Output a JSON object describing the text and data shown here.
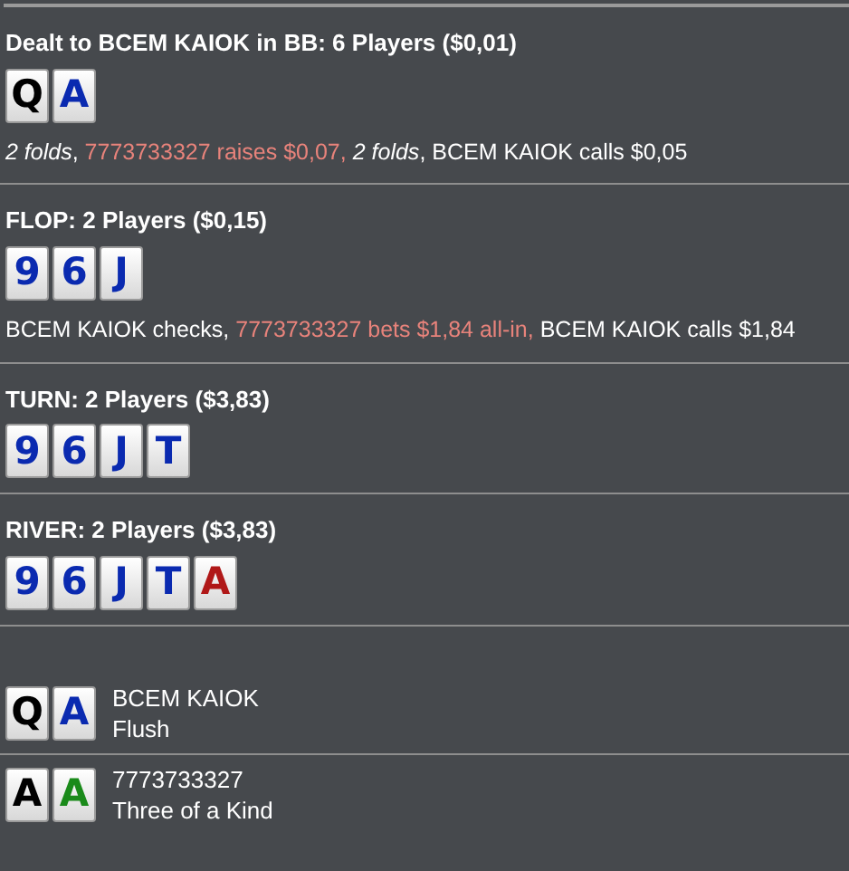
{
  "streets": [
    {
      "title": "Dealt to BCEM KAIOK in BB: 6 Players ($0,01)",
      "cards": [
        {
          "rank": "Q",
          "color": "#000000"
        },
        {
          "rank": "A",
          "color": "#0a2ab0"
        }
      ],
      "actions": [
        {
          "text": "2 folds",
          "kind": "fold"
        },
        {
          "text": ", ",
          "kind": "plain"
        },
        {
          "text": "7773733327 raises $0,07, ",
          "kind": "bet"
        },
        {
          "text": "2 folds",
          "kind": "fold"
        },
        {
          "text": ", BCEM KAIOK calls $0,05",
          "kind": "plain"
        }
      ]
    },
    {
      "title": "FLOP: 2 Players ($0,15)",
      "cards": [
        {
          "rank": "9",
          "color": "#0a2ab0"
        },
        {
          "rank": "6",
          "color": "#0a2ab0"
        },
        {
          "rank": "J",
          "color": "#0a2ab0"
        }
      ],
      "actions": [
        {
          "text": "BCEM KAIOK checks, ",
          "kind": "plain"
        },
        {
          "text": "7773733327 bets $1,84 all-in, ",
          "kind": "bet"
        },
        {
          "text": "BCEM KAIOK calls $1,84",
          "kind": "plain"
        }
      ]
    },
    {
      "title": "TURN: 2 Players ($3,83)",
      "cards": [
        {
          "rank": "9",
          "color": "#0a2ab0"
        },
        {
          "rank": "6",
          "color": "#0a2ab0"
        },
        {
          "rank": "J",
          "color": "#0a2ab0"
        },
        {
          "rank": "T",
          "color": "#0a2ab0"
        }
      ]
    },
    {
      "title": "RIVER: 2 Players ($3,83)",
      "cards": [
        {
          "rank": "9",
          "color": "#0a2ab0"
        },
        {
          "rank": "6",
          "color": "#0a2ab0"
        },
        {
          "rank": "J",
          "color": "#0a2ab0"
        },
        {
          "rank": "T",
          "color": "#0a2ab0"
        },
        {
          "rank": "A",
          "color": "#b01818"
        }
      ]
    }
  ],
  "showdown": [
    {
      "player": "BCEM KAIOK",
      "hand": "Flush",
      "cards": [
        {
          "rank": "Q",
          "color": "#000000"
        },
        {
          "rank": "A",
          "color": "#0a2ab0"
        }
      ]
    },
    {
      "player": "7773733327",
      "hand": "Three of a Kind",
      "cards": [
        {
          "rank": "A",
          "color": "#000000"
        },
        {
          "rank": "A",
          "color": "#1a8a1a"
        }
      ]
    }
  ]
}
